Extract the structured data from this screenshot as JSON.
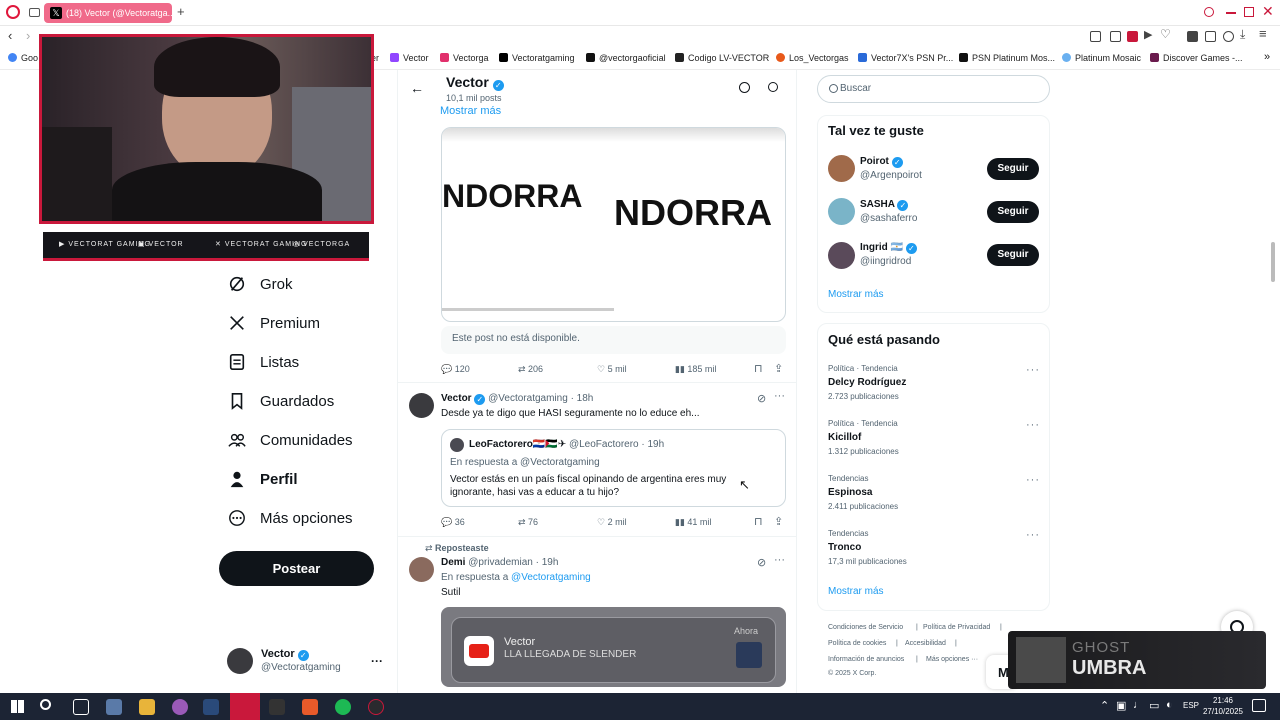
{
  "browser": {
    "tab_title": "(18) Vector (@Vectoratga...",
    "new_tab": "+",
    "bookmarks": [
      "Goo",
      "er",
      "Vector",
      "Vectorga",
      "Vectoratgaming",
      "@vectorgaoficial",
      "Codigo LV-VECTOR",
      "Los_Vectorgas",
      "Vector7X's PSN Pr...",
      "PSN Platinum Mos...",
      "Platinum Mosaic",
      "Discover Games -..."
    ],
    "colors": {
      "tab": "#f06a8a",
      "accent": "#1d9bf0"
    }
  },
  "stream_overlay": {
    "socials": [
      "VECTORAT GAMING",
      "VECTOR",
      "VECTORAT GAMING",
      "VECTORGA"
    ],
    "border_color": "#c9183b"
  },
  "sidebar": {
    "items": [
      {
        "label": "Grok",
        "icon": "grok-icon"
      },
      {
        "label": "Premium",
        "icon": "x-logo-icon"
      },
      {
        "label": "Listas",
        "icon": "list-icon"
      },
      {
        "label": "Guardados",
        "icon": "bookmark-icon"
      },
      {
        "label": "Comunidades",
        "icon": "people-icon"
      },
      {
        "label": "Perfil",
        "icon": "person-icon"
      },
      {
        "label": "Más opciones",
        "icon": "more-circle-icon"
      }
    ],
    "post_button": "Postear",
    "account": {
      "name": "Vector",
      "handle": "@Vectoratgaming",
      "more": "···"
    }
  },
  "profile_header": {
    "name": "Vector",
    "posts": "10,1 mil posts"
  },
  "feed": {
    "show_more": "Mostrar más",
    "media_text_1": "NDORRA",
    "media_text_2": "NDORRA",
    "unavailable": "Este post no está disponible.",
    "post1_stats": {
      "replies": "120",
      "reposts": "206",
      "likes": "5 mil",
      "views": "185 mil"
    },
    "post2": {
      "name": "Vector",
      "handle": "@Vectoratgaming",
      "time": "· 18h",
      "text": "Desde ya te digo que HASI seguramente no lo educe eh...",
      "quote": {
        "name": "LeoFactorero🇵🇾🇵🇸✈",
        "handle": "@LeoFactorero",
        "time": "· 19h",
        "reply_to": "En respuesta a @Vectoratgaming",
        "text": "Vector estás en un país fiscal opinando de argentina eres muy ignorante, hasi vas a educar a tu hijo?"
      },
      "stats": {
        "replies": "36",
        "reposts": "76",
        "likes": "2 mil",
        "views": "41 mil"
      }
    },
    "post3": {
      "repost_label": "Reposteaste",
      "name": "Demi",
      "handle": "@privademian",
      "time": "· 19h",
      "reply_prefix": "En respuesta a",
      "reply_handle": "@Vectoratgaming",
      "text": "Sutil",
      "notification": {
        "title": "Vector",
        "subtitle": "LLA LLEGADA DE SLENDER",
        "time": "Ahora"
      }
    }
  },
  "right": {
    "search_placeholder": "Buscar",
    "suggestions_title": "Tal vez te guste",
    "suggestions": [
      {
        "name": "Poirot",
        "handle": "@Argenpoirot",
        "button": "Seguir"
      },
      {
        "name": "SASHA",
        "handle": "@sashaferro",
        "button": "Seguir"
      },
      {
        "name": "Ingrid 🇦🇷",
        "handle": "@iingridrod",
        "button": "Seguir"
      }
    ],
    "suggestions_more": "Mostrar más",
    "trends_title": "Qué está pasando",
    "trends": [
      {
        "category": "Política · Tendencia",
        "name": "Delcy Rodríguez",
        "count": "2.723 publicaciones"
      },
      {
        "category": "Política · Tendencia",
        "name": "Kicillof",
        "count": "1.312 publicaciones"
      },
      {
        "category": "Tendencias",
        "name": "Espinosa",
        "count": "2.411 publicaciones"
      },
      {
        "category": "Tendencias",
        "name": "Tronco",
        "count": "17,3 mil publicaciones"
      }
    ],
    "trends_more": "Mostrar más",
    "footer": [
      "Condiciones de Servicio",
      "|",
      "Política de Privacidad",
      "|",
      "Política de cookies",
      "|",
      "Accesibilidad",
      "|",
      "Información de anuncios",
      "|",
      "Más opciones ···",
      "© 2025 X Corp."
    ]
  },
  "game_overlay": {
    "line1": "GHOST",
    "line2": "UMBRA"
  },
  "taskbar": {
    "lang": "ESP",
    "time": "21:46",
    "date": "27/10/2025"
  }
}
